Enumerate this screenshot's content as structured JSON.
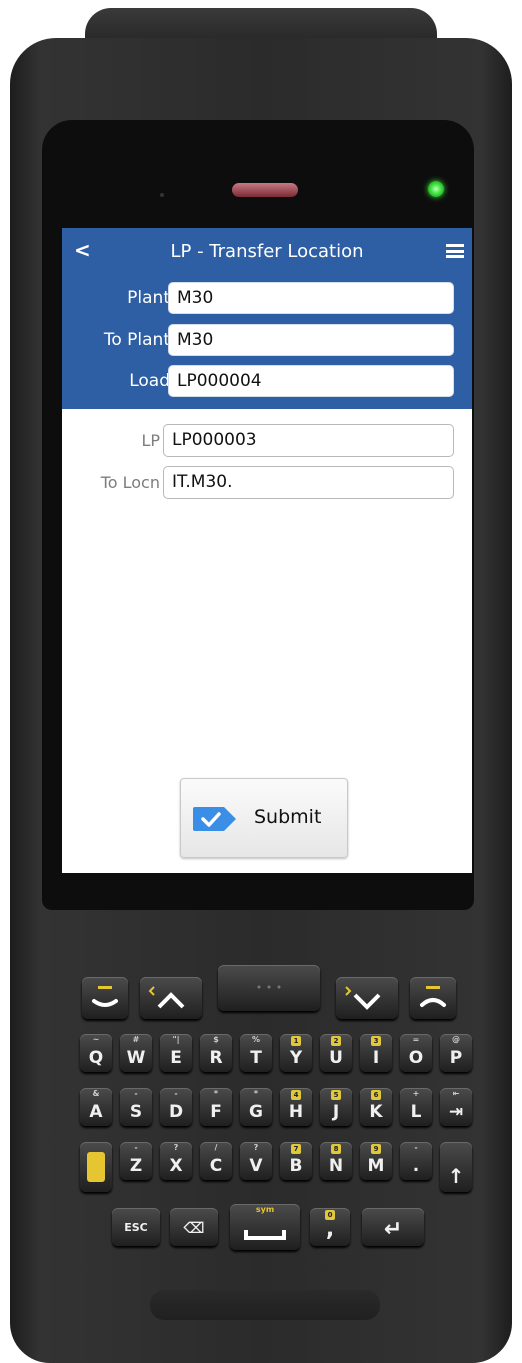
{
  "app": {
    "title": "LP - Transfer Location",
    "back_icon": "<"
  },
  "header_fields": [
    {
      "label": "Plant",
      "value": "M30"
    },
    {
      "label": "To Plant",
      "value": "M30"
    },
    {
      "label": "Load",
      "value": "LP000004"
    }
  ],
  "body_fields": [
    {
      "label": "LP",
      "value": "LP000003"
    },
    {
      "label": "To Locn",
      "value": "IT.M30."
    }
  ],
  "submit": {
    "label": "Submit"
  },
  "colors": {
    "header": "#2e5ea3",
    "submit_icon": "#3a8ee6",
    "led": "#3ee13e"
  },
  "keypad": {
    "row1": [
      {
        "char": "Q",
        "sub": "~"
      },
      {
        "char": "W",
        "sub": "#"
      },
      {
        "char": "E",
        "sub": "\"|"
      },
      {
        "char": "R",
        "sub": "$"
      },
      {
        "char": "T",
        "sub": "%"
      },
      {
        "char": "Y",
        "sub": "1"
      },
      {
        "char": "U",
        "sub": "2"
      },
      {
        "char": "I",
        "sub": "3"
      },
      {
        "char": "O",
        "sub": "="
      },
      {
        "char": "P",
        "sub": "@"
      }
    ],
    "row2": [
      {
        "char": "A",
        "sub": "&"
      },
      {
        "char": "S",
        "sub": "-"
      },
      {
        "char": "D",
        "sub": "-"
      },
      {
        "char": "F",
        "sub": "*"
      },
      {
        "char": "G",
        "sub": "*"
      },
      {
        "char": "H",
        "sub": "4"
      },
      {
        "char": "J",
        "sub": "5"
      },
      {
        "char": "K",
        "sub": "6"
      },
      {
        "char": "L",
        "sub": "+"
      },
      {
        "char": "⇥",
        "sub": "⇤"
      }
    ],
    "row3": [
      {
        "char": "Z",
        "sub": "-"
      },
      {
        "char": "X",
        "sub": "?"
      },
      {
        "char": "C",
        "sub": "/"
      },
      {
        "char": "V",
        "sub": "?"
      },
      {
        "char": "B",
        "sub": "7"
      },
      {
        "char": "N",
        "sub": "8"
      },
      {
        "char": "M",
        "sub": "9"
      },
      {
        "char": ".",
        "sub": "-"
      }
    ],
    "shift": "↑",
    "esc": "ESC",
    "backspace": "⌫",
    "space_sub": "sym",
    "comma": ",",
    "comma_sub": "0",
    "enter": "↵"
  }
}
